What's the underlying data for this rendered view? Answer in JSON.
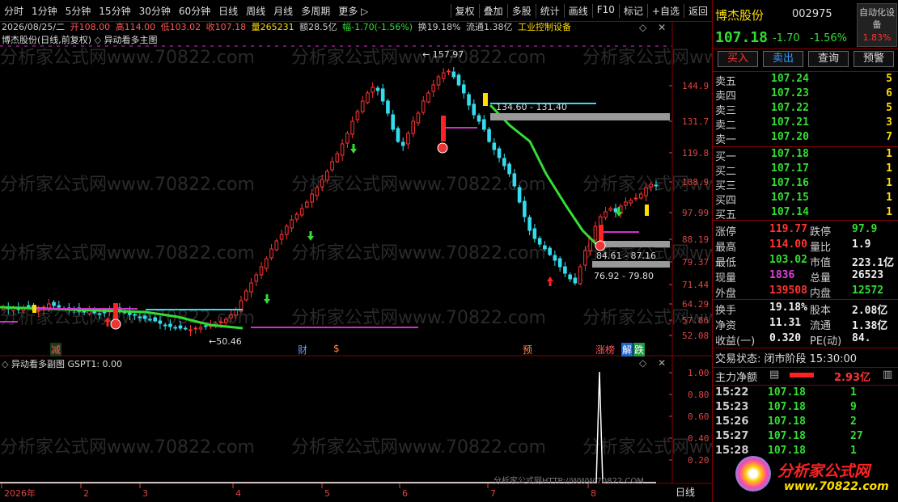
{
  "toolbar": {
    "left_items": [
      "分时",
      "1分钟",
      "5分钟",
      "15分钟",
      "30分钟",
      "60分钟",
      "日线",
      "周线",
      "月线",
      "多周期",
      "更多 ▷"
    ],
    "right_items": [
      "复权",
      "叠加",
      "多股",
      "统计",
      "画线",
      "F10",
      "标记",
      "+自选",
      "返回"
    ]
  },
  "chart": {
    "title": "博杰股份(日线,前复权)",
    "indicator_name": "异动看多主图",
    "date": "2026/08/25/二",
    "open": "开108.00",
    "high": "高114.00",
    "low": "低103.02",
    "close": "收107.18",
    "volume": "量265231",
    "amount": "额28.5亿",
    "change": "幅-1.70(-1.56%)",
    "turnover": "换19.18%",
    "float": "流通1.38亿",
    "industry": "工业控制设备",
    "y_ticks": [
      "144.9",
      "131.7",
      "119.8",
      "108.9",
      "97.99",
      "88.19",
      "79.37",
      "71.44",
      "64.29",
      "57.86",
      "52.08"
    ],
    "max_label": "157.97",
    "min_label": "50.46",
    "zone_labels": [
      "134.60 - 131.40",
      "84.61 - 87.16",
      "76.92 - 79.80"
    ],
    "event_markers": [
      "减",
      "财",
      "$",
      "预",
      "涨榜",
      "解",
      "跌"
    ],
    "sub_title": "异动看多副图  GSPT1: 0.00",
    "sub_ticks": [
      "1.00",
      "0.80",
      "0.60",
      "0.40",
      "0.20"
    ],
    "x_labels": [
      "2026年",
      "2",
      "3",
      "4",
      "5",
      "6",
      "7",
      "8"
    ],
    "period_label": "日线",
    "watermark": "分析家公式网www.70822.com",
    "footer_watermark": "分析家公式网HTTP://WWW.70822.COM"
  },
  "quote": {
    "name": "博杰股份",
    "code": "002975",
    "badge": "自动化设备",
    "badge_pct": "1.83%",
    "price": "107.18",
    "change": "-1.70",
    "change_pct": "-1.56%",
    "buttons": [
      "买入",
      "卖出",
      "查询",
      "预警"
    ],
    "asks": [
      {
        "label": "卖五",
        "price": "107.24",
        "vol": "5"
      },
      {
        "label": "卖四",
        "price": "107.23",
        "vol": "6"
      },
      {
        "label": "卖三",
        "price": "107.22",
        "vol": "5"
      },
      {
        "label": "卖二",
        "price": "107.21",
        "vol": "3"
      },
      {
        "label": "卖一",
        "price": "107.20",
        "vol": "7"
      }
    ],
    "bids": [
      {
        "label": "买一",
        "price": "107.18",
        "vol": "1"
      },
      {
        "label": "买二",
        "price": "107.17",
        "vol": "1"
      },
      {
        "label": "买三",
        "price": "107.16",
        "vol": "1"
      },
      {
        "label": "买四",
        "price": "107.15",
        "vol": "1"
      },
      {
        "label": "买五",
        "price": "107.14",
        "vol": "1"
      }
    ],
    "stats": [
      {
        "l1": "涨停",
        "v1": "119.77",
        "l2": "跌停",
        "v2": "97.9"
      },
      {
        "l1": "最高",
        "v1": "114.00",
        "l2": "量比",
        "v2": "1.9"
      },
      {
        "l1": "最低",
        "v1": "103.02",
        "l2": "市值",
        "v2": "223.1亿"
      },
      {
        "l1": "现量",
        "v1": "1836",
        "l2": "总量",
        "v2": "26523"
      },
      {
        "l1": "外盘",
        "v1": "139508",
        "l2": "内盘",
        "v2": "12572"
      }
    ],
    "stats2": [
      {
        "l1": "换手",
        "v1": "19.18%",
        "l2": "股本",
        "v2": "2.08亿"
      },
      {
        "l1": "净资",
        "v1": "11.31",
        "l2": "流通",
        "v2": "1.38亿"
      },
      {
        "l1": "收益(一)",
        "v1": "0.320",
        "l2": "PE(动)",
        "v2": "84."
      }
    ],
    "trade_status": "交易状态: 闭市阶段 15:30:00",
    "main_net_label": "主力净额",
    "main_net_value": "2.93亿",
    "ticks": [
      {
        "t": "15:22",
        "p": "107.18",
        "v": "1"
      },
      {
        "t": "15:23",
        "p": "107.18",
        "v": "9"
      },
      {
        "t": "15:26",
        "p": "107.18",
        "v": "2"
      },
      {
        "t": "15:27",
        "p": "107.18",
        "v": "27"
      },
      {
        "t": "15:28",
        "p": "107.18",
        "v": "1"
      }
    ],
    "logo_text": "分析家公式网",
    "logo_url": "www.70822.com"
  }
}
